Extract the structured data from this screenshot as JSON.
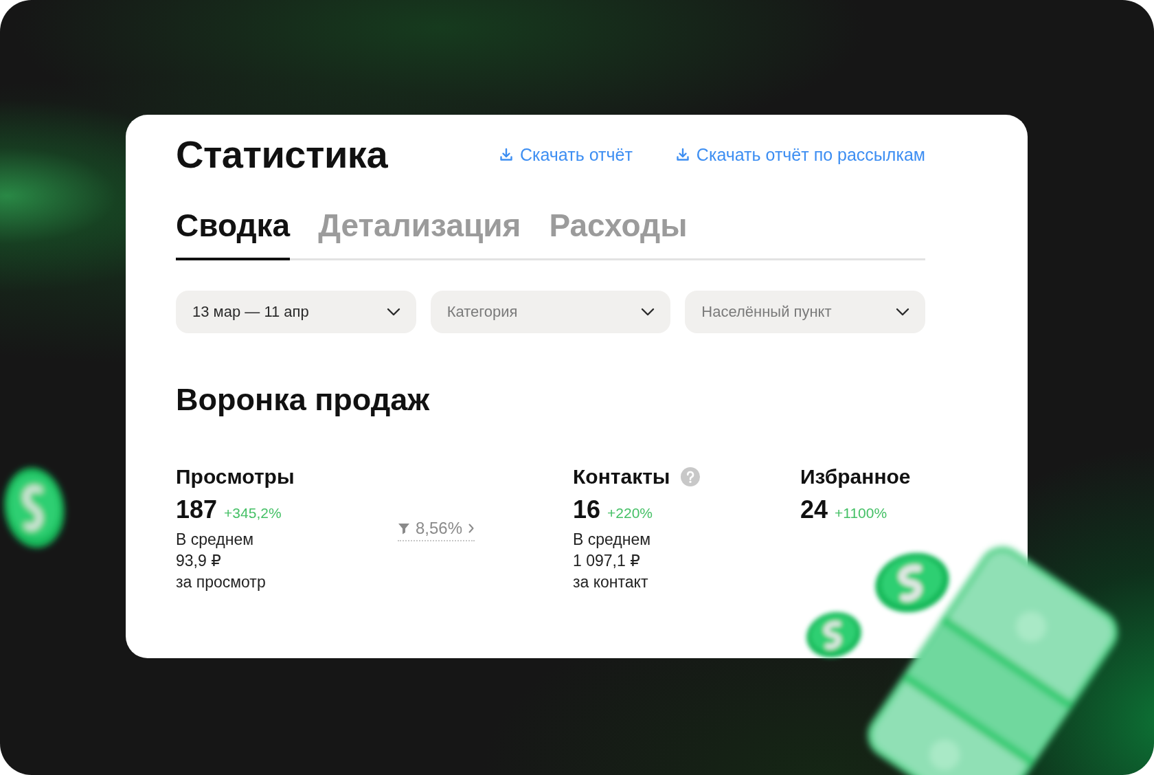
{
  "header": {
    "title": "Статистика",
    "links": [
      {
        "label": "Скачать отчёт"
      },
      {
        "label": "Скачать отчёт по рассылкам"
      }
    ]
  },
  "tabs": [
    {
      "label": "Сводка",
      "selected": true
    },
    {
      "label": "Детализация",
      "selected": false
    },
    {
      "label": "Расходы",
      "selected": false
    }
  ],
  "filters": [
    {
      "value": "13 мар — 11 апр"
    },
    {
      "placeholder": "Категория"
    },
    {
      "placeholder": "Населённый пункт"
    }
  ],
  "funnel": {
    "title": "Воронка продаж",
    "metrics": [
      {
        "label": "Просмотры",
        "help": false,
        "value": "187",
        "change": "+345,2%",
        "average": [
          "В среднем",
          "93,9 ₽",
          "за просмотр"
        ],
        "conversion": "8,56%"
      },
      {
        "label": "Контакты",
        "help": true,
        "value": "16",
        "change": "+220%",
        "average": [
          "В среднем",
          "1 097,1 ₽",
          "за контакт"
        ]
      },
      {
        "label": "Избранное",
        "help": false,
        "value": "24",
        "change": "+1100%"
      }
    ]
  }
}
